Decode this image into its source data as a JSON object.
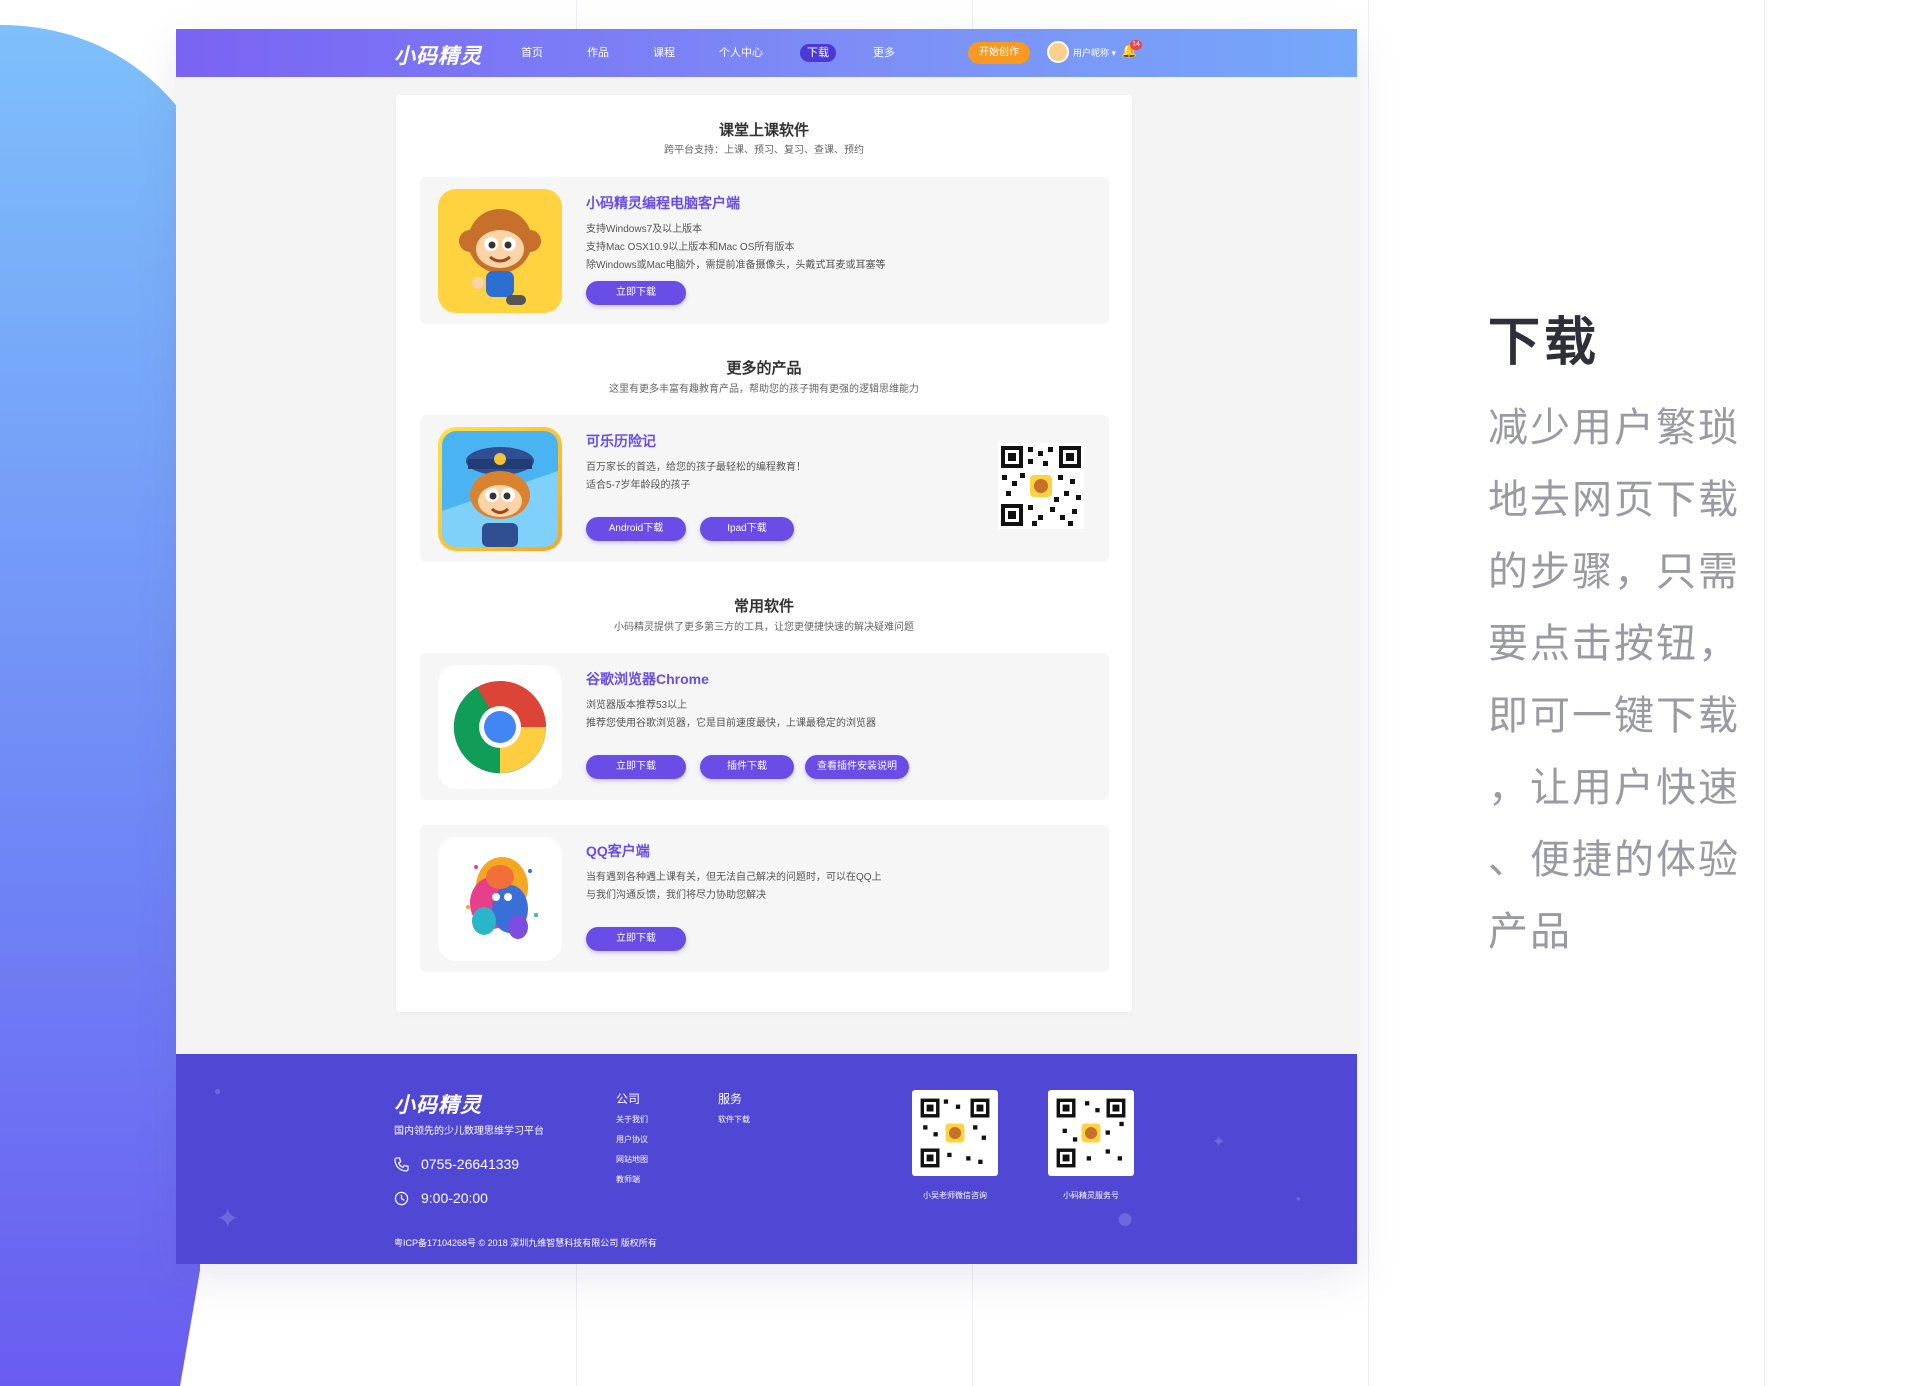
{
  "nav": {
    "logo": "小码精灵",
    "items": [
      "首页",
      "作品",
      "课程",
      "个人中心",
      "下载",
      "更多"
    ],
    "active_index": 4,
    "start_button": "开始创作",
    "username": "用户昵称 ▾",
    "notification_count": "14"
  },
  "sections": [
    {
      "title": "课堂上课软件",
      "subtitle": "跨平台支持：上课、预习、复习、查课、预约",
      "items": [
        {
          "title": "小码精灵编程电脑客户端",
          "desc": [
            "支持Windows7及以上版本",
            "支持Mac OSX10.9以上版本和Mac OS所有版本",
            "除Windows或Mac电脑外，需提前准备摄像头，头戴式耳麦或耳塞等"
          ],
          "buttons": [
            "立即下载"
          ]
        }
      ]
    },
    {
      "title": "更多的产品",
      "subtitle": "这里有更多丰富有趣教育产品，帮助您的孩子拥有更强的逻辑思维能力",
      "items": [
        {
          "title": "可乐历险记",
          "desc": [
            "百万家长的首选，给您的孩子最轻松的编程教育！",
            "适合5-7岁年龄段的孩子"
          ],
          "buttons": [
            "Android下载",
            "Ipad下载"
          ]
        }
      ]
    },
    {
      "title": "常用软件",
      "subtitle": "小码精灵提供了更多第三方的工具，让您更便捷快速的解决疑难问题",
      "items": [
        {
          "title": "谷歌浏览器Chrome",
          "desc": [
            "浏览器版本推荐53以上",
            "推荐您使用谷歌浏览器，它是目前速度最快，上课最稳定的浏览器"
          ],
          "buttons": [
            "立即下载",
            "插件下载",
            "查看插件安装说明"
          ]
        },
        {
          "title": "QQ客户端",
          "desc": [
            "当有遇到各种遇上课有关，但无法自己解决的问题时，可以在QQ上",
            "与我们沟通反馈，我们将尽力协助您解决"
          ],
          "buttons": [
            "立即下载"
          ]
        }
      ]
    }
  ],
  "footer": {
    "logo": "小码精灵",
    "tagline": "国内领先的少儿数理思维学习平台",
    "phone": "0755-26641339",
    "hours": "9:00-20:00",
    "col1_title": "公司",
    "col1_links": [
      "关于我们",
      "用户协议",
      "网站地图",
      "教师端"
    ],
    "col2_title": "服务",
    "col2_links": [
      "软件下载"
    ],
    "qr_captions": [
      "小吴老师微信咨询",
      "小码精灵服务号"
    ],
    "copyright": "粤ICP备17104268号 © 2018 深圳九维智慧科技有限公司 版权所有"
  },
  "side": {
    "heading": "下载",
    "lines": [
      "减少用户繁琐",
      "地去网页下载",
      "的步骤，只需",
      "要点击按钮，",
      "即可一键下载",
      "，让用户快速",
      "、便捷的体验",
      "产品"
    ]
  },
  "colors": {
    "accent": "#6a4de6",
    "nav_active": "#4a38d8",
    "start": "#f79a1f",
    "footer": "#5047d4",
    "badge": "#f3404b"
  }
}
